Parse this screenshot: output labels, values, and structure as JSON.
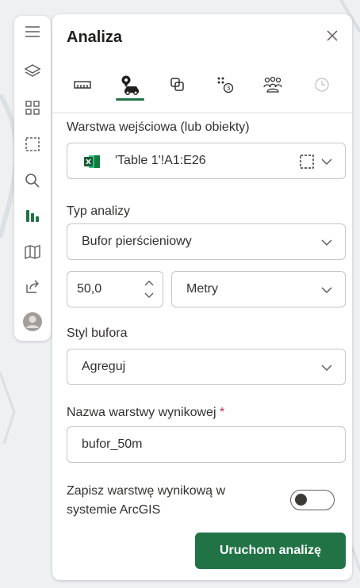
{
  "panel": {
    "title": "Analiza",
    "tabs": [
      {
        "icon": "ruler-icon"
      },
      {
        "icon": "route-car-icon",
        "active": true
      },
      {
        "icon": "overlay-shapes-icon"
      },
      {
        "icon": "points-count-icon"
      },
      {
        "icon": "people-group-icon"
      },
      {
        "icon": "clock-icon"
      }
    ]
  },
  "rail": {
    "items": [
      "menu-icon",
      "layers-icon",
      "qr-grid-icon",
      "select-area-icon",
      "search-icon",
      "chart-bars-icon",
      "map-icon",
      "share-icon",
      "user-avatar-icon"
    ]
  },
  "input_layer": {
    "label": "Warstwa wejściowa (lub obiekty)",
    "value": "'Table 1'!A1:E26"
  },
  "analysis_type": {
    "label": "Typ analizy",
    "value": "Bufor pierścieniowy"
  },
  "distance": {
    "value": "50,0",
    "unit": "Metry"
  },
  "buffer_style": {
    "label": "Styl bufora",
    "value": "Agreguj"
  },
  "output_name": {
    "label": "Nazwa warstwy wynikowej",
    "required_mark": "*",
    "value": "bufor_50m"
  },
  "save_to_arcgis": {
    "label_line1": "Zapisz warstwę wynikową w",
    "label_line2": "systemie ArcGIS",
    "enabled": false
  },
  "run_button": {
    "label": "Uruchom analizę"
  },
  "colors": {
    "accent": "#217346",
    "required": "#c4314b"
  }
}
